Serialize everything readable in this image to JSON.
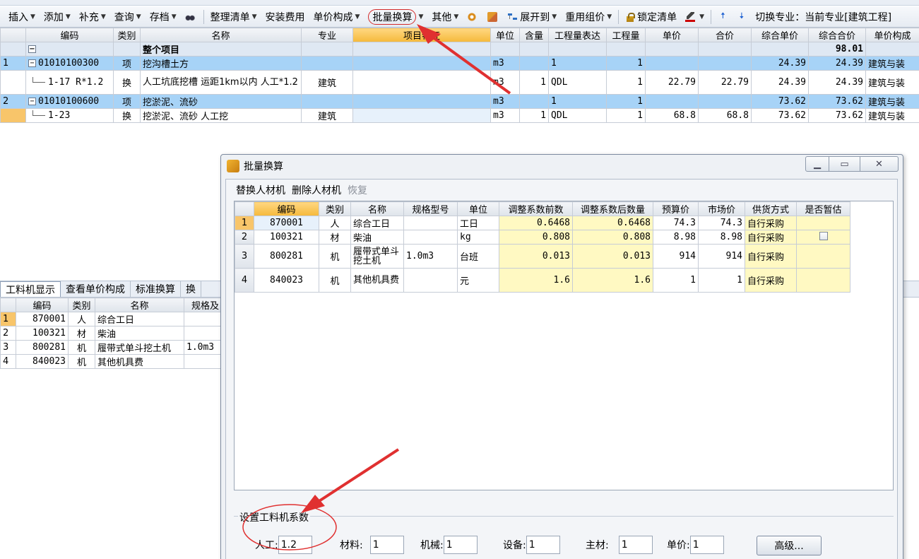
{
  "toolbar": {
    "items": [
      "插入",
      "添加",
      "补充",
      "查询",
      "存档",
      "整理清单",
      "安装费用",
      "单价构成",
      "批量换算",
      "其他",
      "展开到",
      "重用组价",
      "锁定清单"
    ],
    "switch_label": "切换专业：当前专业[建筑工程]"
  },
  "main_grid": {
    "headers": [
      "编码",
      "类别",
      "名称",
      "专业",
      "项目特征",
      "单位",
      "含量",
      "工程量表达",
      "工程量",
      "单价",
      "合价",
      "综合单价",
      "综合合价",
      "单价构成"
    ],
    "total_row": {
      "name": "整个项目",
      "total": "98.01"
    },
    "rows": [
      {
        "idx": "1",
        "code": "01010100300",
        "type": "项",
        "name": "挖沟槽土方",
        "spec": "",
        "unit": "m3",
        "qty": "",
        "expr": "1",
        "amount": "1",
        "price": "",
        "sum": "",
        "comp_price": "24.39",
        "comp_sum": "24.39",
        "build": "建筑与装"
      },
      {
        "idx": "",
        "code": "1-17 R*1.2",
        "type": "换",
        "name": "人工坑底挖槽 运距1km以内 人工*1.2",
        "spec": "建筑",
        "unit": "m3",
        "qty": "1",
        "expr": "QDL",
        "amount": "1",
        "price": "22.79",
        "sum": "22.79",
        "comp_price": "24.39",
        "comp_sum": "24.39",
        "build": "建筑与装"
      },
      {
        "idx": "2",
        "code": "01010100600",
        "type": "项",
        "name": "挖淤泥、流砂",
        "spec": "",
        "unit": "m3",
        "qty": "",
        "expr": "1",
        "amount": "1",
        "price": "",
        "sum": "",
        "comp_price": "73.62",
        "comp_sum": "73.62",
        "build": "建筑与装"
      },
      {
        "idx": "",
        "code": "1-23",
        "type": "换",
        "name": "挖淤泥、流砂 人工挖",
        "spec": "建筑",
        "unit": "m3",
        "qty": "1",
        "expr": "QDL",
        "amount": "1",
        "price": "68.8",
        "sum": "68.8",
        "comp_price": "73.62",
        "comp_sum": "73.62",
        "build": "建筑与装"
      }
    ]
  },
  "bottom": {
    "tabs": [
      "工料机显示",
      "查看单价构成",
      "标准换算",
      "换"
    ],
    "headers": [
      "编码",
      "类别",
      "名称",
      "规格及"
    ],
    "rows": [
      {
        "idx": "1",
        "code": "870001",
        "type": "人",
        "name": "综合工日",
        "spec": ""
      },
      {
        "idx": "2",
        "code": "100321",
        "type": "材",
        "name": "柴油",
        "spec": ""
      },
      {
        "idx": "3",
        "code": "800281",
        "type": "机",
        "name": "履带式单斗挖土机",
        "spec": "1.0m3"
      },
      {
        "idx": "4",
        "code": "840023",
        "type": "机",
        "name": "其他机具费",
        "spec": ""
      }
    ]
  },
  "dialog": {
    "title": "批量换算",
    "toolbar": [
      "替换人材机",
      "删除人材机",
      "恢复"
    ],
    "headers": [
      "编码",
      "类别",
      "名称",
      "规格型号",
      "单位",
      "调整系数前数",
      "调整系数后数量",
      "预算价",
      "市场价",
      "供货方式",
      "是否暂估"
    ],
    "rows": [
      {
        "idx": "1",
        "code": "870001",
        "type": "人",
        "name": "综合工日",
        "spec": "",
        "unit": "工日",
        "before": "0.6468",
        "after": "0.6468",
        "budget": "74.3",
        "market": "74.3",
        "supply": "自行采购"
      },
      {
        "idx": "2",
        "code": "100321",
        "type": "材",
        "name": "柴油",
        "spec": "",
        "unit": "kg",
        "before": "0.808",
        "after": "0.808",
        "budget": "8.98",
        "market": "8.98",
        "supply": "自行采购"
      },
      {
        "idx": "3",
        "code": "800281",
        "type": "机",
        "name": "履带式单斗挖土机",
        "spec": "1.0m3",
        "unit": "台班",
        "before": "0.013",
        "after": "0.013",
        "budget": "914",
        "market": "914",
        "supply": "自行采购"
      },
      {
        "idx": "4",
        "code": "840023",
        "type": "机",
        "name": "其他机具费",
        "spec": "",
        "unit": "元",
        "before": "1.6",
        "after": "1.6",
        "budget": "1",
        "market": "1",
        "supply": "自行采购"
      }
    ],
    "coef_title": "设置工料机系数",
    "coef": {
      "labor_label": "人工:",
      "labor": "1.2",
      "material_label": "材料:",
      "material": "1",
      "machine_label": "机械:",
      "machine": "1",
      "equipment_label": "设备:",
      "equipment": "1",
      "main_label": "主材:",
      "main": "1",
      "unit_label": "单价:",
      "unit": "1"
    },
    "advanced": "高级..."
  },
  "colors": {
    "accent_red": "#e03030",
    "row_blue": "#a7d3f7",
    "cell_yellow": "#fff9c2",
    "header_orange": "#f5b93b"
  }
}
